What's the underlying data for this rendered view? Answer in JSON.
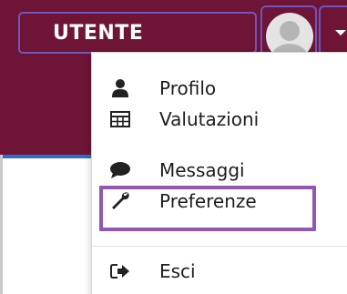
{
  "navbar": {
    "user_label": "UTENTE"
  },
  "menu": {
    "items": [
      {
        "label": "Profilo",
        "icon": "user-icon"
      },
      {
        "label": "Valutazioni",
        "icon": "table-icon"
      },
      {
        "label": "Messaggi",
        "icon": "comment-icon"
      },
      {
        "label": "Preferenze",
        "icon": "wrench-icon"
      },
      {
        "label": "Esci",
        "icon": "sign-out-icon"
      }
    ],
    "highlighted": "Preferenze"
  },
  "colors": {
    "navbar_bg": "#6e1436",
    "highlight_border": "#9457b0",
    "frame_border": "#6f56b8"
  }
}
